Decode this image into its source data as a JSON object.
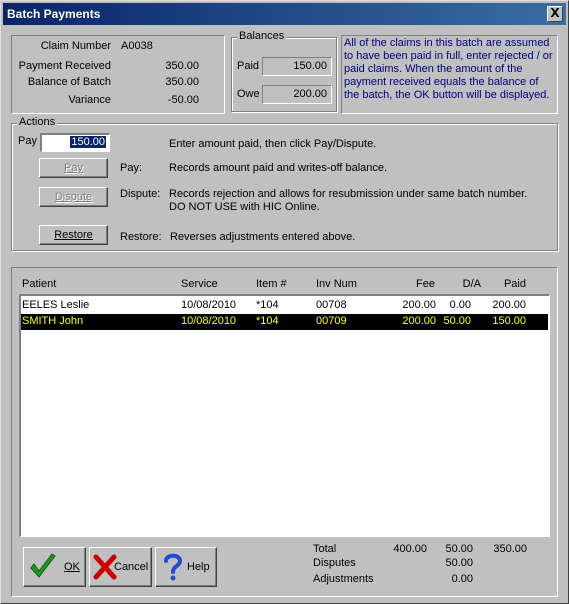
{
  "window": {
    "title": "Batch Payments",
    "close_glyph": "X"
  },
  "claim": {
    "claim_number_label": "Claim Number",
    "claim_number_value": "A0038",
    "payment_received_label": "Payment Received",
    "payment_received_value": "350.00",
    "balance_of_batch_label": "Balance of Batch",
    "balance_of_batch_value": "350.00",
    "variance_label": "Variance",
    "variance_value": "-50.00"
  },
  "balances": {
    "group_label": "Balances",
    "paid_label": "Paid",
    "paid_value": "150.00",
    "owe_label": "Owe",
    "owe_value": "200.00"
  },
  "info_text": "All of the claims in this batch are assumed to have been paid in full, enter rejected / or paid claims. When the amount of the payment received equals the balance of the batch, the OK button will be displayed.",
  "actions": {
    "group_label": "Actions",
    "pay_label": "Pay",
    "pay_input_value": "150.00",
    "pay_hint": "Enter amount paid, then click Pay/Dispute.",
    "pay_button": "Pay",
    "pay_desc_label": "Pay:",
    "pay_desc": "Records amount paid and writes-off balance.",
    "dispute_button": "Dispute",
    "dispute_desc_label": "Dispute:",
    "dispute_desc_1": "Records rejection and allows for resubmission under same batch number.",
    "dispute_desc_2": "DO NOT USE with HIC Online.",
    "restore_button": "Restore",
    "restore_desc_label": "Restore:",
    "restore_desc": "Reverses adjustments entered above."
  },
  "table": {
    "headers": {
      "patient": "Patient",
      "service": "Service",
      "item": "Item #",
      "inv": "Inv Num",
      "fee": "Fee",
      "da": "D/A",
      "paid": "Paid"
    },
    "rows": [
      {
        "patient": "EELES Leslie",
        "service": "10/08/2010",
        "item": "*104",
        "inv": "00708",
        "fee": "200.00",
        "da": "0.00",
        "paid": "200.00",
        "selected": false
      },
      {
        "patient": "SMITH John",
        "service": "10/08/2010",
        "item": "*104",
        "inv": "00709",
        "fee": "200.00",
        "da": "50.00",
        "paid": "150.00",
        "selected": true
      }
    ]
  },
  "totals": {
    "total_label": "Total",
    "total_fee": "400.00",
    "total_da": "50.00",
    "total_paid": "350.00",
    "disputes_label": "Disputes",
    "disputes_da": "50.00",
    "adjustments_label": "Adjustments",
    "adjustments_da": "0.00"
  },
  "buttons": {
    "ok": "OK",
    "cancel": "Cancel",
    "help": "Help"
  },
  "colors": {
    "titlebar_start": "#0a246a",
    "titlebar_end": "#3a6ea5",
    "selected_row_bg": "#000000",
    "selected_row_text": "#ffff00",
    "info_text": "#000080",
    "ok_check": "#1f9a1f",
    "cancel_x": "#cc0000",
    "help_q": "#1a4fd6"
  },
  "icons": {
    "ok": "checkmark-icon",
    "cancel": "red-x-icon",
    "help": "question-mark-icon"
  }
}
